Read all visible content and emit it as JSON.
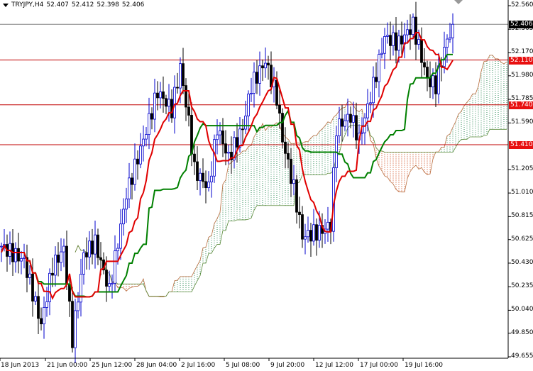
{
  "header": {
    "symbol": "TRYJPY,H4",
    "open": "52.407",
    "high": "52.412",
    "low": "52.398",
    "close": "52.406"
  },
  "price_axis": {
    "ticks": [
      "52.560",
      "52.365",
      "52.170",
      "51.980",
      "51.785",
      "51.590",
      "51.205",
      "51.010",
      "50.815",
      "50.625",
      "50.430",
      "50.235",
      "50.040",
      "49.850",
      "49.655"
    ],
    "range": [
      49.655,
      52.56
    ]
  },
  "price_tags": [
    {
      "label": "52.406",
      "value": 52.406,
      "color": "#000000",
      "line_color": "#808080"
    },
    {
      "label": "52.110",
      "value": 52.11,
      "color": "#e81010",
      "line_color": "#c00000"
    },
    {
      "label": "51.740",
      "value": 51.74,
      "color": "#e81010",
      "line_color": "#c00000"
    },
    {
      "label": "51.410",
      "value": 51.41,
      "color": "#e81010",
      "line_color": "#c00000"
    }
  ],
  "time_axis": {
    "labels": [
      "18 Jun 2013",
      "21 Jun 00:00",
      "25 Jun 12:00",
      "28 Jun 04:00",
      "2 Jul 16:00",
      "5 Jul 08:00",
      "9 Jul 20:00",
      "12 Jul 12:00",
      "17 Jul 00:00",
      "19 Jul 16:00"
    ]
  },
  "colors": {
    "bull": "#0000cc",
    "bear": "#000000",
    "tenkan": "#e00000",
    "kijun": "#008000",
    "cloud_up": "#2e8b57",
    "cloud_down": "#cc3300"
  },
  "chart_data": {
    "type": "candlestick",
    "title": "TRYJPY,H4",
    "indicator": "Ichimoku (9,26,52)",
    "bars": 160,
    "price_path_bar_index_to_price": [
      [
        0,
        50.57
      ],
      [
        8,
        50.45
      ],
      [
        14,
        49.92
      ],
      [
        18,
        50.4
      ],
      [
        22,
        50.55
      ],
      [
        25,
        49.8
      ],
      [
        29,
        50.5
      ],
      [
        33,
        50.6
      ],
      [
        38,
        50.2
      ],
      [
        44,
        51.0
      ],
      [
        50,
        51.45
      ],
      [
        55,
        51.85
      ],
      [
        60,
        51.7
      ],
      [
        63,
        52.05
      ],
      [
        66,
        51.6
      ],
      [
        68,
        51.2
      ],
      [
        73,
        51.05
      ],
      [
        76,
        51.55
      ],
      [
        80,
        51.3
      ],
      [
        85,
        51.55
      ],
      [
        88,
        51.9
      ],
      [
        93,
        52.1
      ],
      [
        97,
        51.8
      ],
      [
        99,
        51.45
      ],
      [
        103,
        51.05
      ],
      [
        106,
        50.65
      ],
      [
        113,
        50.7
      ],
      [
        116,
        50.75
      ],
      [
        118,
        51.55
      ],
      [
        123,
        51.65
      ],
      [
        126,
        51.45
      ],
      [
        131,
        51.9
      ],
      [
        135,
        52.3
      ],
      [
        140,
        52.25
      ],
      [
        145,
        52.4
      ],
      [
        150,
        51.95
      ],
      [
        153,
        51.9
      ],
      [
        156,
        52.2
      ],
      [
        159,
        52.406
      ]
    ]
  }
}
